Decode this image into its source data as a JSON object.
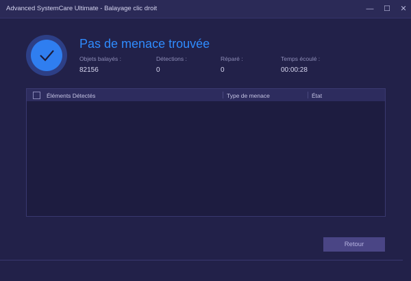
{
  "window": {
    "title": "Advanced SystemCare Ultimate - Balayage clic droit",
    "minimize": "—",
    "maximize": "☐",
    "close": "✕"
  },
  "result": {
    "headline": "Pas de menace trouvée",
    "icon": "check-icon"
  },
  "stats": [
    {
      "label": "Objets balayés :",
      "value": "82156"
    },
    {
      "label": "Détections :",
      "value": "0"
    },
    {
      "label": "Réparé :",
      "value": "0"
    },
    {
      "label": "Temps écoulé :",
      "value": "00:00:28"
    }
  ],
  "table": {
    "columns": [
      "Éléments Détectés",
      "Type de menace",
      "État"
    ],
    "rows": []
  },
  "actions": {
    "back": "Retour"
  }
}
